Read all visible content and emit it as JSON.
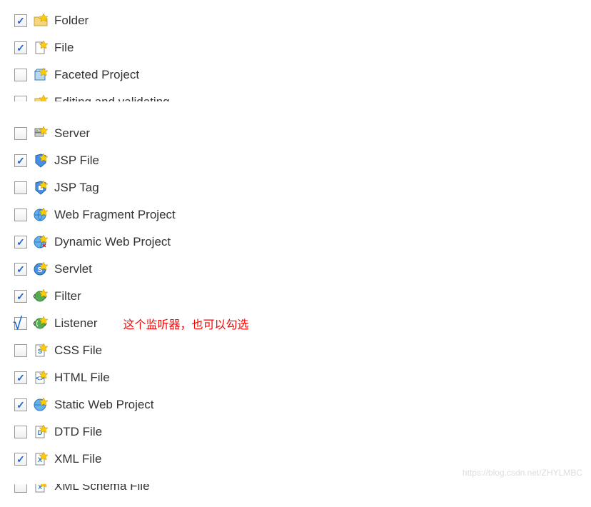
{
  "items": [
    {
      "label": "Folder",
      "checked": true,
      "icon": "folder",
      "clip": ""
    },
    {
      "label": "File",
      "checked": true,
      "icon": "file",
      "clip": ""
    },
    {
      "label": "Faceted Project",
      "checked": false,
      "icon": "faceted",
      "clip": ""
    },
    {
      "label": "Editing and validating",
      "checked": false,
      "icon": "edit",
      "clip": "top"
    },
    {
      "label": "Server",
      "checked": false,
      "icon": "server",
      "clip": ""
    },
    {
      "label": "JSP File",
      "checked": true,
      "icon": "jspfile",
      "clip": ""
    },
    {
      "label": "JSP Tag",
      "checked": false,
      "icon": "jsptag",
      "clip": ""
    },
    {
      "label": "Web Fragment Project",
      "checked": false,
      "icon": "webfrag",
      "clip": ""
    },
    {
      "label": "Dynamic Web Project",
      "checked": true,
      "icon": "dynweb",
      "clip": ""
    },
    {
      "label": "Servlet",
      "checked": true,
      "icon": "servlet",
      "clip": ""
    },
    {
      "label": "Filter",
      "checked": true,
      "icon": "filter",
      "clip": ""
    },
    {
      "label": "Listener",
      "checked": false,
      "icon": "listener",
      "clip": "",
      "drawn": true,
      "annotation": "这个监听器，也可以勾选"
    },
    {
      "label": "CSS File",
      "checked": false,
      "icon": "css",
      "clip": ""
    },
    {
      "label": "HTML File",
      "checked": true,
      "icon": "html",
      "clip": ""
    },
    {
      "label": "Static Web Project",
      "checked": true,
      "icon": "staticweb",
      "clip": ""
    },
    {
      "label": "DTD File",
      "checked": false,
      "icon": "dtd",
      "clip": ""
    },
    {
      "label": "XML File",
      "checked": true,
      "icon": "xml",
      "clip": ""
    },
    {
      "label": "XML Schema File",
      "checked": false,
      "icon": "xsd",
      "clip": "bottom"
    }
  ],
  "watermark": "https://blog.csdn.net/ZHYLMBC"
}
